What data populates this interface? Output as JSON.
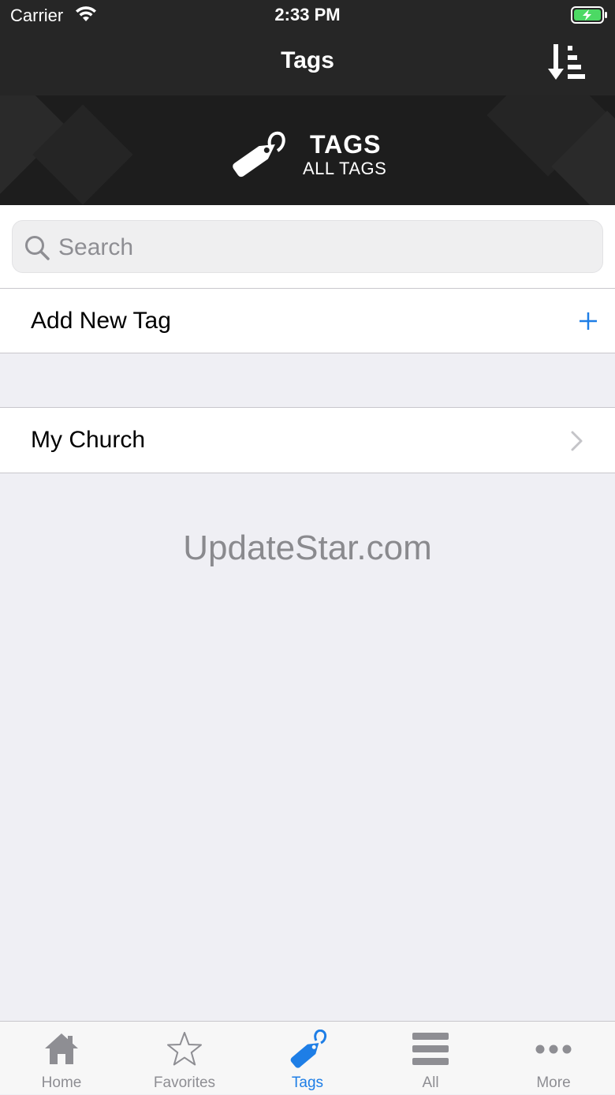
{
  "status_bar": {
    "carrier": "Carrier",
    "time": "2:33 PM"
  },
  "nav": {
    "title": "Tags",
    "sort_icon": "sort-descending-icon"
  },
  "banner": {
    "title": "TAGS",
    "subtitle": "ALL TAGS",
    "icon": "tag-icon"
  },
  "search": {
    "placeholder": "Search",
    "value": ""
  },
  "add_row": {
    "label": "Add New Tag",
    "icon": "plus-icon"
  },
  "tags": [
    {
      "label": "My Church"
    }
  ],
  "watermark": "UpdateStar.com",
  "tabbar": {
    "items": [
      {
        "label": "Home",
        "icon": "home-icon"
      },
      {
        "label": "Favorites",
        "icon": "star-icon"
      },
      {
        "label": "Tags",
        "icon": "tag-icon"
      },
      {
        "label": "All",
        "icon": "list-icon"
      },
      {
        "label": "More",
        "icon": "more-dots-icon"
      }
    ],
    "active": "Tags"
  },
  "colors": {
    "accent": "#1e7ee6",
    "nav_background": "#262626",
    "battery_charging": "#4cd964"
  }
}
